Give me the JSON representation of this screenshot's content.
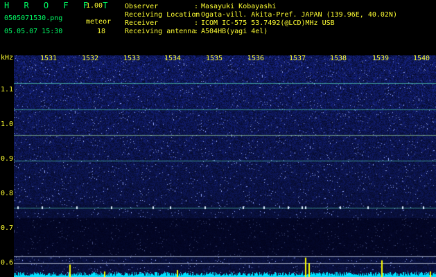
{
  "header": {
    "title": "H R O F F T",
    "version": "1.00",
    "filename": "0505071530.png",
    "datetime": "05.05.07 15:30",
    "meteor_label": "meteor",
    "meteor_count": "18"
  },
  "info": [
    {
      "label": "Observer",
      "value": "Masayuki Kobayashi"
    },
    {
      "label": "Receiving Location",
      "value": "Ogata-vill. Akita-Pref. JAPAN (139.96E, 40.02N)"
    },
    {
      "label": "Receiver",
      "value": "ICOM IC-575 53.7492(@LCD)MHz USB"
    },
    {
      "label": "Receiving antenna",
      "value": "A504HB(yagi 4el)"
    }
  ],
  "axis": {
    "unit": "kHz",
    "time_ticks": [
      "1531",
      "1532",
      "1533",
      "1534",
      "1535",
      "1536",
      "1537",
      "1538",
      "1539",
      "1540"
    ],
    "freq_ticks": [
      "1.1",
      "1.0",
      "0.9",
      "0.8",
      "0.7",
      "0.6"
    ]
  },
  "colors": {
    "background": "#000000",
    "label_yellow": "#ffff33",
    "title_green": "#00ff66",
    "spectrum_blue": "#1a2a9a",
    "carrier_line": "#aaffcc",
    "meteor_echo": "#ffff00",
    "signal_trace": "#00ffff"
  }
}
